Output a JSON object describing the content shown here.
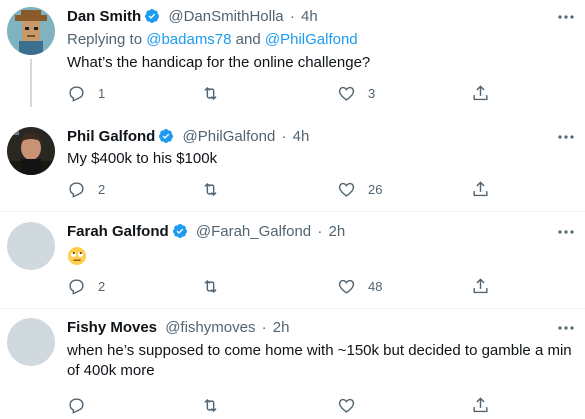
{
  "colors": {
    "accent": "#1d9bf0",
    "muted": "#536471",
    "text": "#0f1419"
  },
  "tweets": [
    {
      "name": "Dan Smith",
      "verified": true,
      "handle": "@DanSmithHolla",
      "separator": "·",
      "time": "4h",
      "replying_prefix": "Replying to",
      "reply_to_1": "@badams78",
      "replying_and": "and",
      "reply_to_2": "@PhilGalfond",
      "text": "What’s the handicap for the online challenge?",
      "replies": "1",
      "retweets": "",
      "likes": "3",
      "avatar": "pixel-cowboy-avatar"
    },
    {
      "name": "Phil Galfond",
      "verified": true,
      "handle": "@PhilGalfond",
      "separator": "·",
      "time": "4h",
      "text": "My $400k to his $100k",
      "replies": "2",
      "retweets": "",
      "likes": "26",
      "avatar": "photo-avatar"
    },
    {
      "name": "Farah Galfond",
      "verified": true,
      "handle": "@Farah_Galfond",
      "separator": "·",
      "time": "2h",
      "text_emoji": "face-with-rolling-eyes",
      "replies": "2",
      "retweets": "",
      "likes": "48",
      "avatar": "default-avatar"
    },
    {
      "name": "Fishy Moves",
      "verified": false,
      "handle": "@fishymoves",
      "separator": "·",
      "time": "2h",
      "text": "when he’s supposed to come home with ~150k but decided to gamble a min of 400k more",
      "replies": "",
      "retweets": "",
      "likes": "",
      "avatar": "default-avatar"
    }
  ]
}
